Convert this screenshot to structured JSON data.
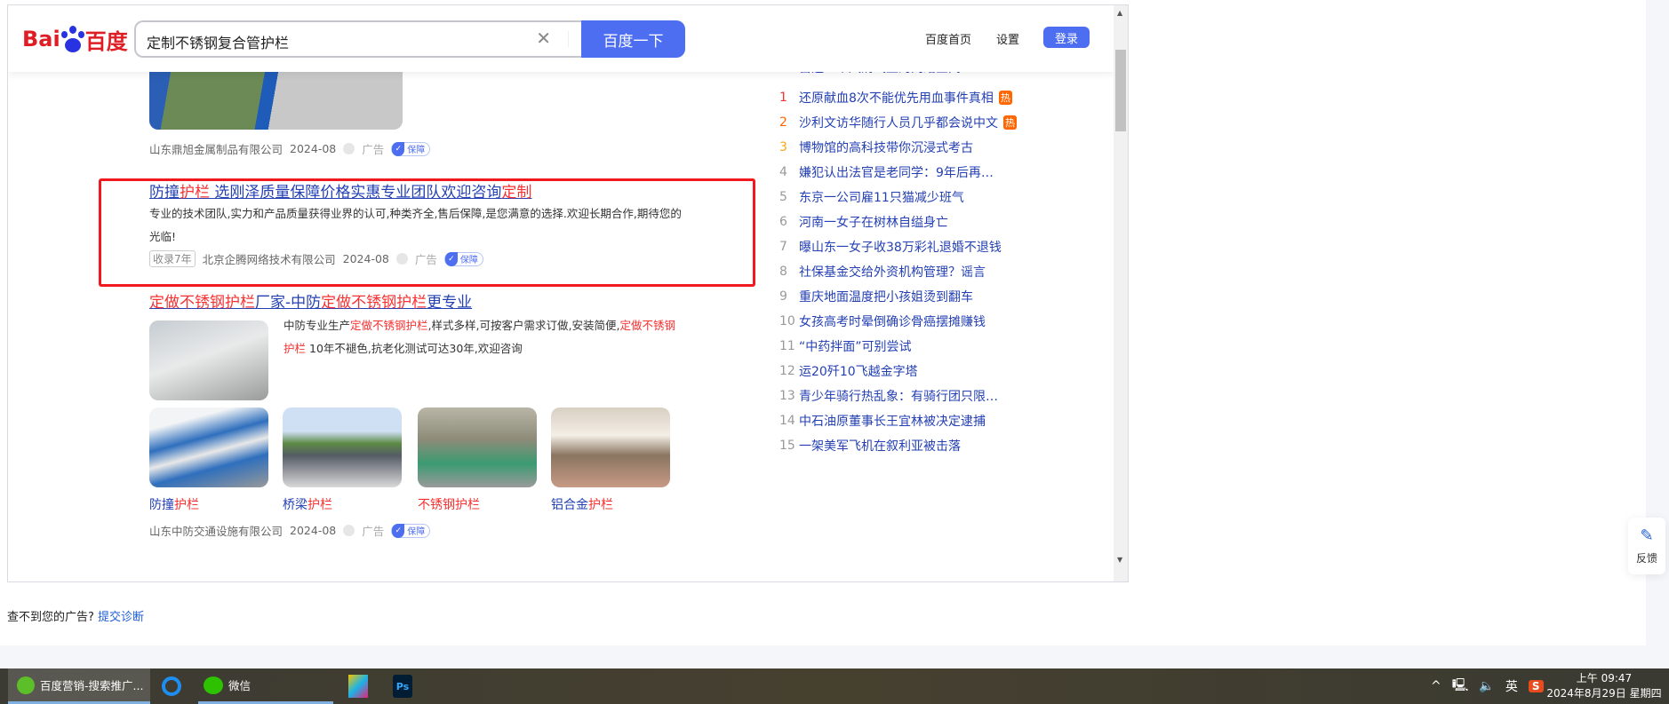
{
  "header": {
    "logo": "Bai du 百度",
    "query": "定制不锈钢复合管护栏",
    "search_btn": "百度一下",
    "home": "百度首页",
    "settings": "设置",
    "login": "登录"
  },
  "results": [
    {
      "company": "山东鼎旭金属制品有限公司",
      "date": "2024-08",
      "ad": "广告",
      "badge": "保障"
    },
    {
      "title": [
        {
          "t": "防撞",
          "hl": false
        },
        {
          "t": "护栏",
          "hl": true
        },
        {
          "t": " 选刚泽质量保障价格实惠专业团队欢迎咨询",
          "hl": false
        },
        {
          "t": "定制",
          "hl": true
        }
      ],
      "desc": "专业的技术团队,实力和产品质量获得业界的认可,种类齐全,售后保障,是您满意的选择.欢迎长期合作,期待您的光临!",
      "tag": "收录7年",
      "company": "北京企腾网络技术有限公司",
      "date": "2024-08",
      "ad": "广告",
      "badge": "保障"
    },
    {
      "title": [
        {
          "t": "定做不锈钢护栏",
          "hl": true
        },
        {
          "t": "厂家-中防",
          "hl": false
        },
        {
          "t": "定做不锈钢护栏",
          "hl": true
        },
        {
          "t": "更专业",
          "hl": false
        }
      ],
      "desc": [
        {
          "t": "中防专业生产",
          "hl": false
        },
        {
          "t": "定做不锈钢护栏",
          "hl": true
        },
        {
          "t": ",样式多样,可按客户需求订做,安装简便,",
          "hl": false
        },
        {
          "t": "定做不锈钢护栏",
          "hl": true
        },
        {
          "t": " 10年不褪色,抗老化测试可达30年,欢迎咨询",
          "hl": false
        }
      ],
      "captions": [
        [
          {
            "t": "防撞",
            "hl": false
          },
          {
            "t": "护栏",
            "hl": true
          }
        ],
        [
          {
            "t": "桥梁",
            "hl": false
          },
          {
            "t": "护栏",
            "hl": true
          }
        ],
        [
          {
            "t": "不锈钢护栏",
            "hl": true
          }
        ],
        [
          {
            "t": "铝合金",
            "hl": false
          },
          {
            "t": "护栏",
            "hl": true
          }
        ]
      ],
      "company": "山东中防交通设施有限公司",
      "date": "2024-08",
      "ad": "广告",
      "badge": "保障"
    }
  ],
  "hot": {
    "top": "营造一个风清气正的网络空间",
    "items": [
      {
        "n": "1",
        "t": "还原献血8次不能优先用血事件真相",
        "hot": "热",
        "c": "#f73131"
      },
      {
        "n": "2",
        "t": "沙利文访华随行人员几乎都会说中文",
        "hot": "热",
        "c": "#ff6600"
      },
      {
        "n": "3",
        "t": "博物馆的高科技带你沉浸式考古",
        "c": "#faa90e"
      },
      {
        "n": "4",
        "t": "嫌犯认出法官是老同学：9年后再…"
      },
      {
        "n": "5",
        "t": "东京一公司雇11只猫减少班气"
      },
      {
        "n": "6",
        "t": "河南一女子在树林自缢身亡"
      },
      {
        "n": "7",
        "t": "曝山东一女子收38万彩礼退婚不退钱"
      },
      {
        "n": "8",
        "t": "社保基金交给外资机构管理？谣言"
      },
      {
        "n": "9",
        "t": "重庆地面温度把小孩姐烫到翻车"
      },
      {
        "n": "10",
        "t": "女孩高考时晕倒确诊骨癌摆摊赚钱"
      },
      {
        "n": "11",
        "t": "“中药拌面”可别尝试"
      },
      {
        "n": "12",
        "t": "运20歼10飞越金字塔"
      },
      {
        "n": "13",
        "t": "青少年骑行热乱象：有骑行团只限…"
      },
      {
        "n": "14",
        "t": "中石油原董事长王宜林被决定逮捕"
      },
      {
        "n": "15",
        "t": "一架美军飞机在叙利亚被击落"
      }
    ]
  },
  "footer": {
    "q": "查不到您的广告?",
    "link": "提交诊断"
  },
  "feedback": "反馈",
  "taskbar": {
    "app1": "百度营销-搜索推广...",
    "app2": "微信",
    "ime": "英",
    "time": "上午 09:47",
    "date": "2024年8月29日 星期四"
  }
}
